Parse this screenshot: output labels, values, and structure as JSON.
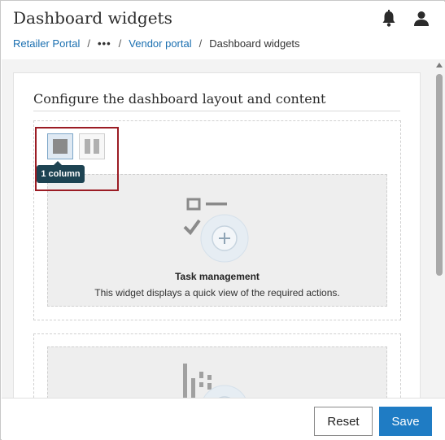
{
  "header": {
    "title": "Dashboard widgets",
    "icons": {
      "notifications": "bell-icon",
      "account": "user-icon"
    }
  },
  "breadcrumb": {
    "items": [
      {
        "label": "Retailer Portal",
        "link": true
      },
      {
        "label": "•••",
        "link": true
      },
      {
        "label": "Vendor portal",
        "link": true
      },
      {
        "label": "Dashboard widgets",
        "link": false
      }
    ],
    "separator": "/"
  },
  "config": {
    "title": "Configure the dashboard layout and content",
    "layout_options": [
      {
        "name": "one-column",
        "selected": true,
        "tooltip": "1 column"
      },
      {
        "name": "two-column",
        "selected": false
      }
    ]
  },
  "widgets": [
    {
      "name": "Task management",
      "description": "This widget displays a quick view of the required actions.",
      "icon": "task-list-icon"
    },
    {
      "name": "",
      "description": "",
      "icon": "chart-bars-icon"
    }
  ],
  "footer": {
    "reset_label": "Reset",
    "save_label": "Save"
  },
  "colors": {
    "link": "#1a6fb0",
    "primary": "#1f7cc4",
    "tooltip_bg": "#1d4352",
    "highlight": "#9b1c24"
  }
}
